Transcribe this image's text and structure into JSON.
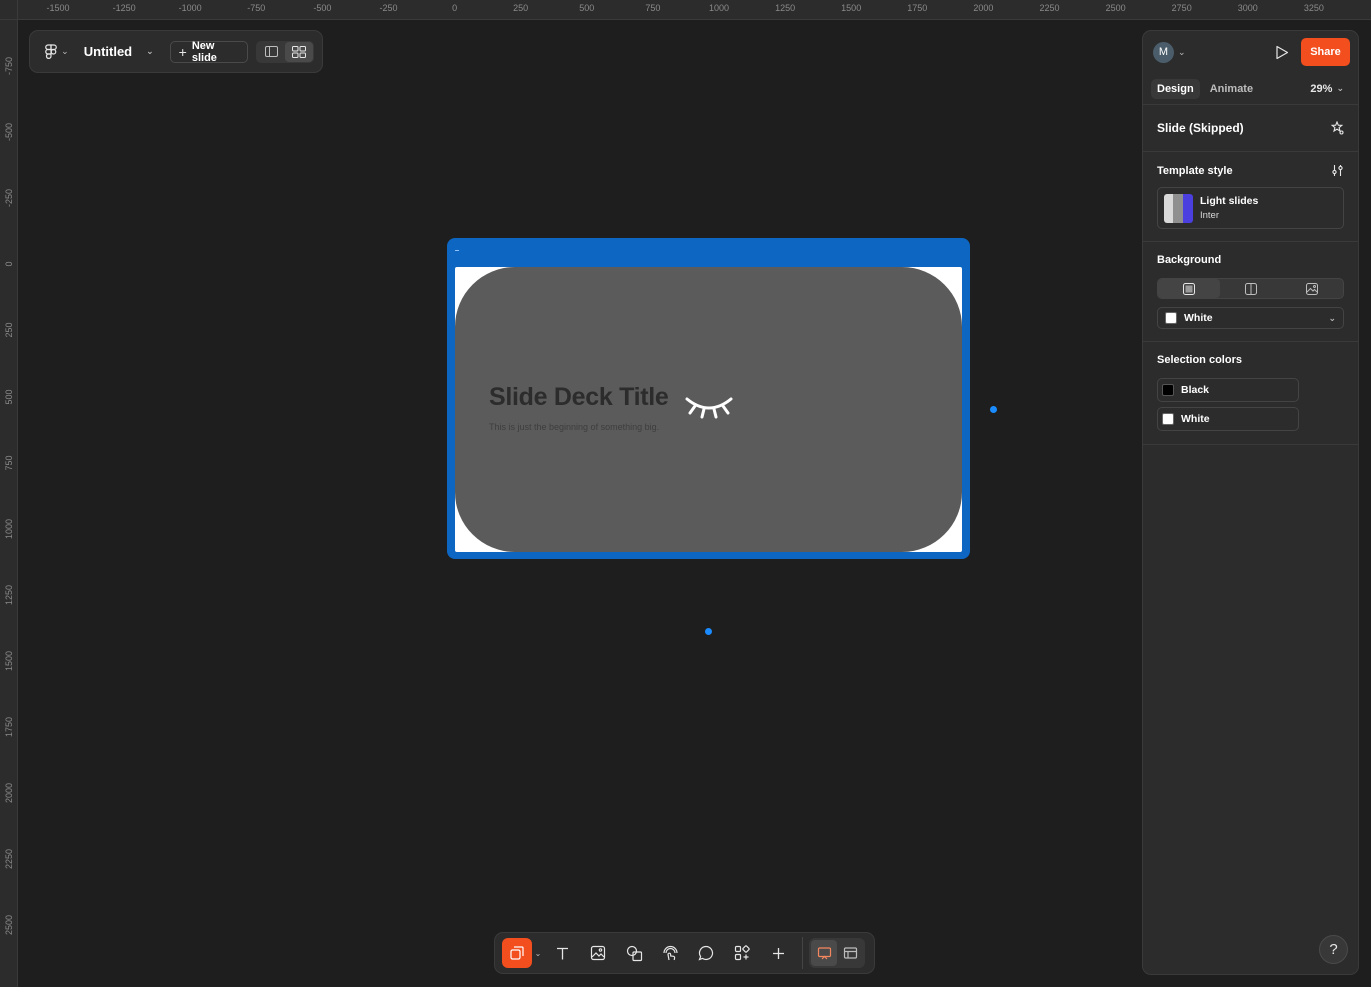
{
  "ruler": {
    "x_ticks": [
      "-1500",
      "-1250",
      "-1000",
      "-750",
      "-500",
      "-250",
      "0",
      "250",
      "500",
      "750",
      "1000",
      "1250",
      "1500",
      "1750",
      "2000",
      "2250",
      "2500",
      "2750",
      "3000",
      "3250"
    ],
    "y_ticks": [
      "-750",
      "-500",
      "-250",
      "0",
      "250",
      "500",
      "750",
      "1000",
      "1250",
      "1500",
      "1750",
      "2000",
      "2250",
      "2500"
    ]
  },
  "header": {
    "doc_title": "Untitled",
    "new_slide_label": "New slide"
  },
  "slide": {
    "title": "Slide Deck Title",
    "subtitle": "This is just the beginning of something big.",
    "hidden_icon": "eye-closed-icon"
  },
  "panel": {
    "avatar_initial": "M",
    "share_label": "Share",
    "tabs": [
      {
        "label": "Design",
        "active": true
      },
      {
        "label": "Animate",
        "active": false
      }
    ],
    "zoom": "29%",
    "selection_title": "Slide (Skipped)",
    "template_style": {
      "heading": "Template style",
      "name": "Light slides",
      "font": "Inter"
    },
    "background": {
      "heading": "Background",
      "fill_value": "White",
      "fill_color": "#ffffff"
    },
    "selection_colors": {
      "heading": "Selection colors",
      "colors": [
        {
          "name": "Black",
          "hex": "#000000"
        },
        {
          "name": "White",
          "hex": "#ffffff"
        }
      ]
    },
    "help_label": "?"
  },
  "colors": {
    "accent": "#f24e1e",
    "selection": "#0d66c2",
    "canvas": "#1e1e1e"
  }
}
